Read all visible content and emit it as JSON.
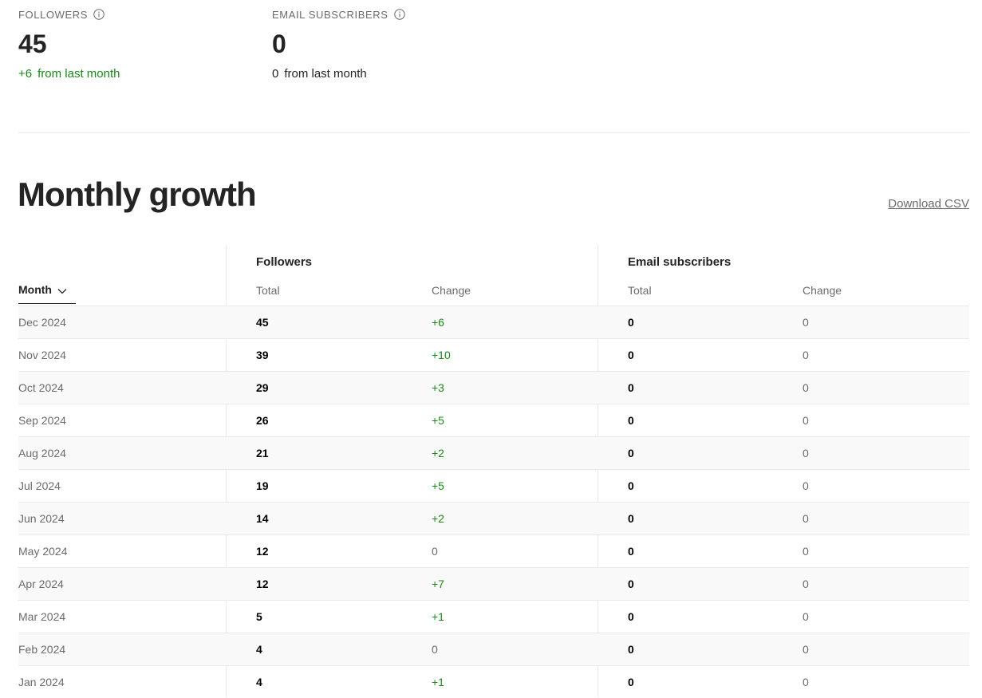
{
  "stats": {
    "followers": {
      "label": "FOLLOWERS",
      "value": "45",
      "delta": "+6",
      "delta_suffix": "from last month"
    },
    "email": {
      "label": "EMAIL SUBSCRIBERS",
      "value": "0",
      "delta": "0",
      "delta_suffix": "from last month"
    }
  },
  "growth": {
    "title": "Monthly growth",
    "download_label": "Download CSV",
    "month_header": "Month",
    "groups": {
      "followers": "Followers",
      "email": "Email subscribers"
    },
    "sub_headers": {
      "total": "Total",
      "change": "Change"
    },
    "rows": [
      {
        "month": "Dec 2024",
        "followers_total": "45",
        "followers_change": "+6",
        "email_total": "0",
        "email_change": "0"
      },
      {
        "month": "Nov 2024",
        "followers_total": "39",
        "followers_change": "+10",
        "email_total": "0",
        "email_change": "0"
      },
      {
        "month": "Oct 2024",
        "followers_total": "29",
        "followers_change": "+3",
        "email_total": "0",
        "email_change": "0"
      },
      {
        "month": "Sep 2024",
        "followers_total": "26",
        "followers_change": "+5",
        "email_total": "0",
        "email_change": "0"
      },
      {
        "month": "Aug 2024",
        "followers_total": "21",
        "followers_change": "+2",
        "email_total": "0",
        "email_change": "0"
      },
      {
        "month": "Jul 2024",
        "followers_total": "19",
        "followers_change": "+5",
        "email_total": "0",
        "email_change": "0"
      },
      {
        "month": "Jun 2024",
        "followers_total": "14",
        "followers_change": "+2",
        "email_total": "0",
        "email_change": "0"
      },
      {
        "month": "May 2024",
        "followers_total": "12",
        "followers_change": "0",
        "email_total": "0",
        "email_change": "0"
      },
      {
        "month": "Apr 2024",
        "followers_total": "12",
        "followers_change": "+7",
        "email_total": "0",
        "email_change": "0"
      },
      {
        "month": "Mar 2024",
        "followers_total": "5",
        "followers_change": "+1",
        "email_total": "0",
        "email_change": "0"
      },
      {
        "month": "Feb 2024",
        "followers_total": "4",
        "followers_change": "0",
        "email_total": "0",
        "email_change": "0"
      },
      {
        "month": "Jan 2024",
        "followers_total": "4",
        "followers_change": "+1",
        "email_total": "0",
        "email_change": "0"
      }
    ]
  },
  "colors": {
    "positive": "#1a8917",
    "muted": "#6b6b6b",
    "text": "#242424",
    "row_alt": "#f9f9f9"
  }
}
